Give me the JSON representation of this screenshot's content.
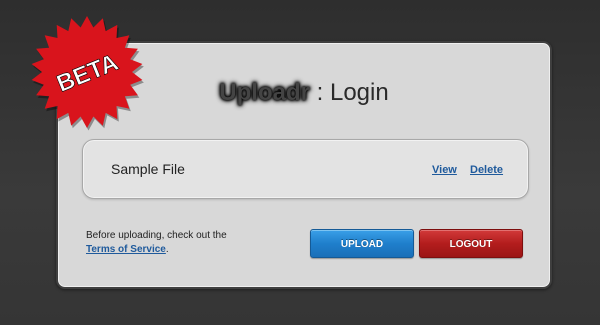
{
  "header": {
    "brand": "Uploadr",
    "separator": " : ",
    "page": "Login"
  },
  "badge": {
    "label": "BETA",
    "color": "#d9141c"
  },
  "files": [
    {
      "name": "Sample File",
      "view_label": "View",
      "delete_label": "Delete"
    }
  ],
  "notice": {
    "prefix": "Before uploading, check out the ",
    "link_text": "Terms of Service",
    "suffix": "."
  },
  "actions": {
    "upload_label": "UPLOAD",
    "logout_label": "LOGOUT"
  },
  "colors": {
    "link": "#1f5a9c",
    "upload": "#1f7fcc",
    "logout": "#b31d1d",
    "panel": "#d8d8d8"
  }
}
